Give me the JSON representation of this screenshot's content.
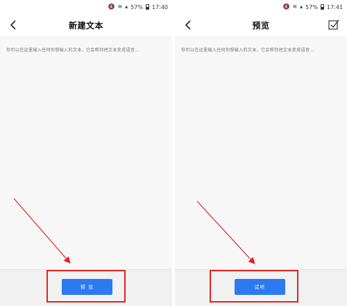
{
  "left_screen": {
    "status": {
      "battery": "57%",
      "time": "17:40"
    },
    "title": "新建文本",
    "hint": "你可以在这里输入任何你想输入的文本，它会帮你把文本变成语音...",
    "button_label": "预 览"
  },
  "right_screen": {
    "status": {
      "battery": "57%",
      "time": "17:41"
    },
    "title": "预览",
    "hint": "你可以在这里输入任何你想输入的文本，它会帮你把文本变成语音...",
    "button_label": "试听"
  },
  "icons": {
    "back": "chevron-left-icon",
    "confirm": "checkbox-check-icon"
  },
  "colors": {
    "primary_button": "#2d79f2",
    "annotation_red": "#e02020"
  }
}
